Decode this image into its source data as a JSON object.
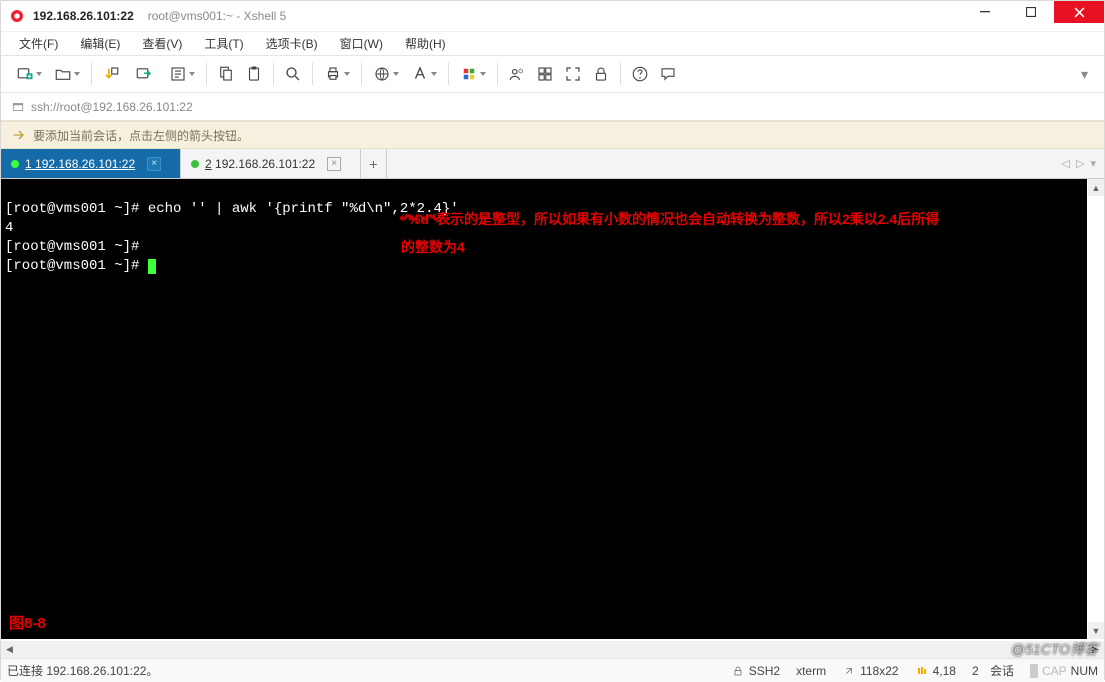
{
  "titlebar": {
    "main": "192.168.26.101:22",
    "sub": "root@vms001:~ - Xshell 5"
  },
  "menus": [
    "文件(F)",
    "编辑(E)",
    "查看(V)",
    "工具(T)",
    "选项卡(B)",
    "窗口(W)",
    "帮助(H)"
  ],
  "address": "ssh://root@192.168.26.101:22",
  "hint": "要添加当前会话，点击左侧的箭头按钮。",
  "tabs": {
    "active": {
      "index": "1",
      "label": "192.168.26.101:22"
    },
    "inactive": {
      "index": "2",
      "label": "192.168.26.101:22"
    }
  },
  "terminal": {
    "line1_prefix": "[root@vms001 ~]# echo '' | awk '{printf \"%d\\n\",",
    "line1_highlight": "2*2.4",
    "line1_suffix": "}'",
    "line2": "4",
    "line3": "[root@vms001 ~]#",
    "line4": "[root@vms001 ~]# ",
    "note_line1": "“%d”表示的是整型，所以如果有小数的情况也会自动转换为整数，所以2乘以2.4后所得的整数为4",
    "fig_label": "图8-8"
  },
  "statusbar": {
    "left": "已连接 192.168.26.101:22。",
    "ssh": "SSH2",
    "term": "xterm",
    "size": "118x22",
    "pos": "4,18",
    "sessions_label": "会话",
    "sessions_count": "2",
    "caps": "CAP",
    "num": "NUM"
  },
  "watermark": "@51CTO博客"
}
